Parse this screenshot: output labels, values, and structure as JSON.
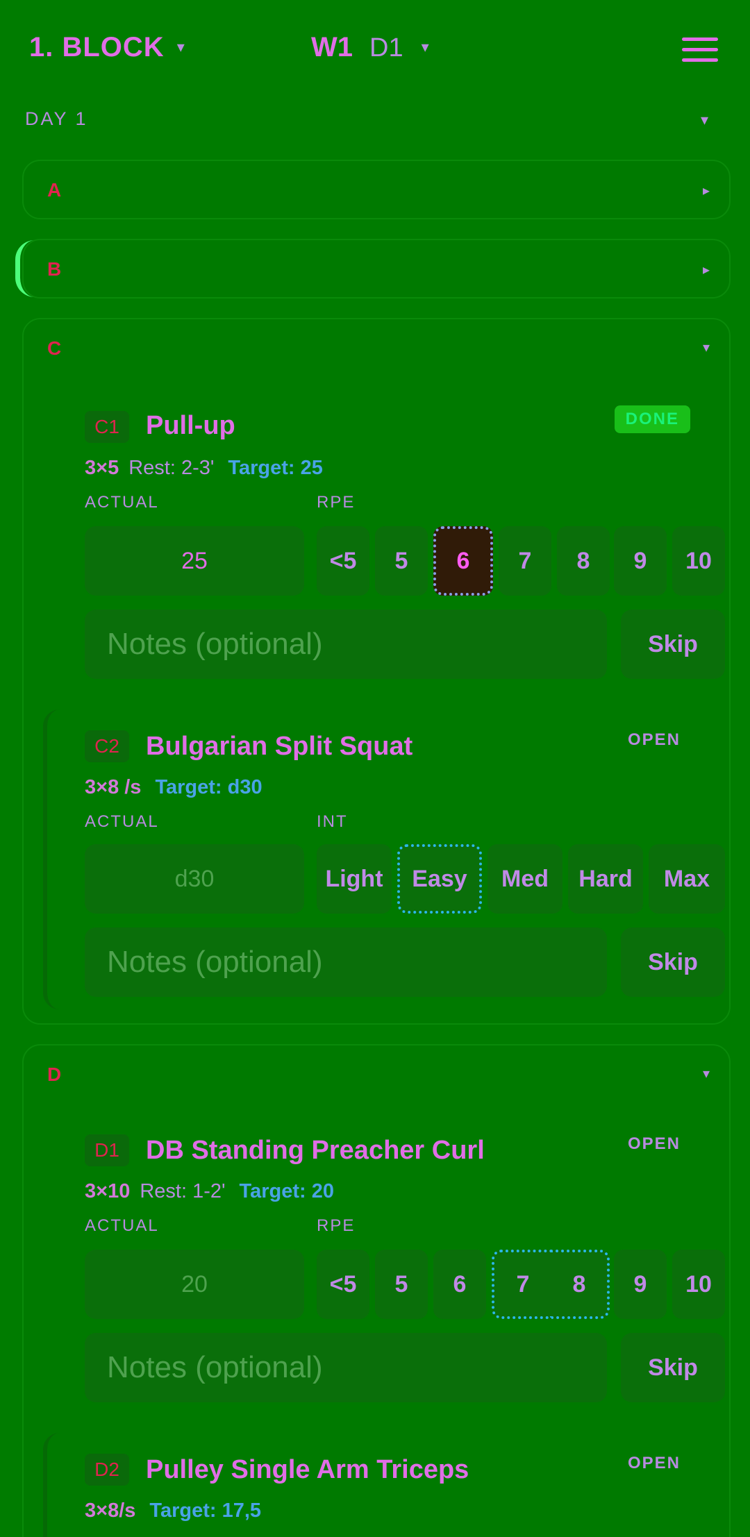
{
  "header": {
    "block_label": "1. BLOCK",
    "week_label": "W1",
    "day_label": "D1",
    "caret": "▾"
  },
  "day": {
    "title": "DAY 1",
    "caret": "▾"
  },
  "sections": {
    "a": {
      "label": "A",
      "toggle": "▸"
    },
    "b": {
      "label": "B",
      "toggle": "▸"
    },
    "c": {
      "label": "C",
      "toggle": "▾"
    },
    "d": {
      "label": "D",
      "toggle": "▾"
    }
  },
  "exercises": {
    "c1": {
      "code": "C1",
      "name": "Pull-up",
      "status": "DONE",
      "sets": "3×5",
      "rest": "Rest: 2-3'",
      "target": "Target: 25",
      "actual_label": "ACTUAL",
      "scale_label": "RPE",
      "actual_value": "25",
      "options": [
        "<5",
        "5",
        "6",
        "7",
        "8",
        "9",
        "10"
      ],
      "selected": "6"
    },
    "c2": {
      "code": "C2",
      "name": "Bulgarian Split Squat",
      "status": "OPEN",
      "sets": "3×8 /s",
      "target": "Target: d30",
      "actual_label": "ACTUAL",
      "scale_label": "INT",
      "actual_placeholder": "d30",
      "options": [
        "Light",
        "Easy",
        "Med",
        "Hard",
        "Max"
      ],
      "suggested": "Easy"
    },
    "d1": {
      "code": "D1",
      "name": "DB Standing Preacher Curl",
      "status": "OPEN",
      "sets": "3×10",
      "rest": "Rest: 1-2'",
      "target": "Target: 20",
      "actual_label": "ACTUAL",
      "scale_label": "RPE",
      "actual_placeholder": "20",
      "options": [
        "<5",
        "5",
        "6",
        "7",
        "8",
        "9",
        "10"
      ],
      "suggested": [
        "7",
        "8"
      ]
    },
    "d2": {
      "code": "D2",
      "name": "Pulley Single Arm Triceps",
      "status": "OPEN",
      "sets": "3×8/s",
      "target": "Target: 17,5"
    }
  },
  "notes_placeholder": "Notes (optional)",
  "skip_label": "Skip",
  "colors": {
    "background": "#007c00",
    "accent_pink": "#e06ee6",
    "section_code_red": "#e0244f",
    "target_blue": "#4aa3e6",
    "done_green": "#19bf19"
  }
}
